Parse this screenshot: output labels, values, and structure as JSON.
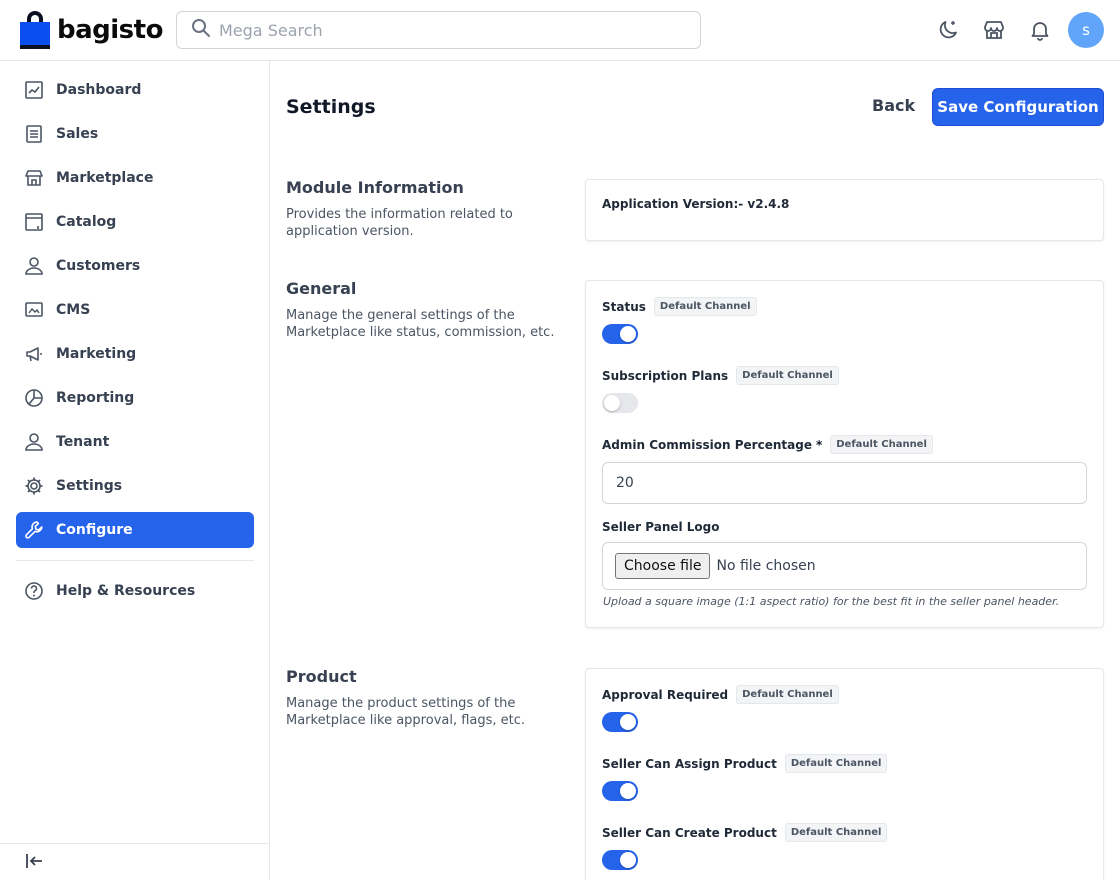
{
  "header": {
    "brand": "bagisto",
    "search_placeholder": "Mega Search",
    "avatar_initial": "s"
  },
  "sidebar": {
    "items": [
      {
        "label": "Dashboard",
        "icon": "dashboard-icon"
      },
      {
        "label": "Sales",
        "icon": "sales-icon"
      },
      {
        "label": "Marketplace",
        "icon": "store-icon"
      },
      {
        "label": "Catalog",
        "icon": "catalog-icon"
      },
      {
        "label": "Customers",
        "icon": "user-icon"
      },
      {
        "label": "CMS",
        "icon": "cms-icon"
      },
      {
        "label": "Marketing",
        "icon": "megaphone-icon"
      },
      {
        "label": "Reporting",
        "icon": "pie-chart-icon"
      },
      {
        "label": "Tenant",
        "icon": "user-icon"
      },
      {
        "label": "Settings",
        "icon": "gear-icon"
      },
      {
        "label": "Configure",
        "icon": "wrench-icon",
        "active": true
      }
    ],
    "help_label": "Help & Resources"
  },
  "page": {
    "title": "Settings",
    "back_label": "Back",
    "save_label": "Save Configuration"
  },
  "sections": {
    "module": {
      "title": "Module Information",
      "description": "Provides the information related to application version.",
      "version_text": "Application Version:- v2.4.8"
    },
    "general": {
      "title": "General",
      "description": "Manage the general settings of the Marketplace like status, commission, etc.",
      "status_label": "Status",
      "status_on": true,
      "subscription_label": "Subscription Plans",
      "subscription_on": false,
      "commission_label": "Admin Commission Percentage",
      "commission_required": "*",
      "commission_value": "20",
      "logo_label": "Seller Panel Logo",
      "file_button": "Choose file",
      "file_status": "No file chosen",
      "logo_hint": "Upload a square image (1:1 aspect ratio) for the best fit in the seller panel header."
    },
    "product": {
      "title": "Product",
      "description": "Manage the product settings of the Marketplace like approval, flags, etc.",
      "approval_label": "Approval Required",
      "approval_on": true,
      "assign_label": "Seller Can Assign Product",
      "assign_on": true,
      "create_label": "Seller Can Create Product",
      "create_on": true
    }
  },
  "channel_chip": "Default Channel",
  "colors": {
    "accent": "#2563eb",
    "brand_blue": "#0a4ef0",
    "avatar": "#60a5fa"
  }
}
